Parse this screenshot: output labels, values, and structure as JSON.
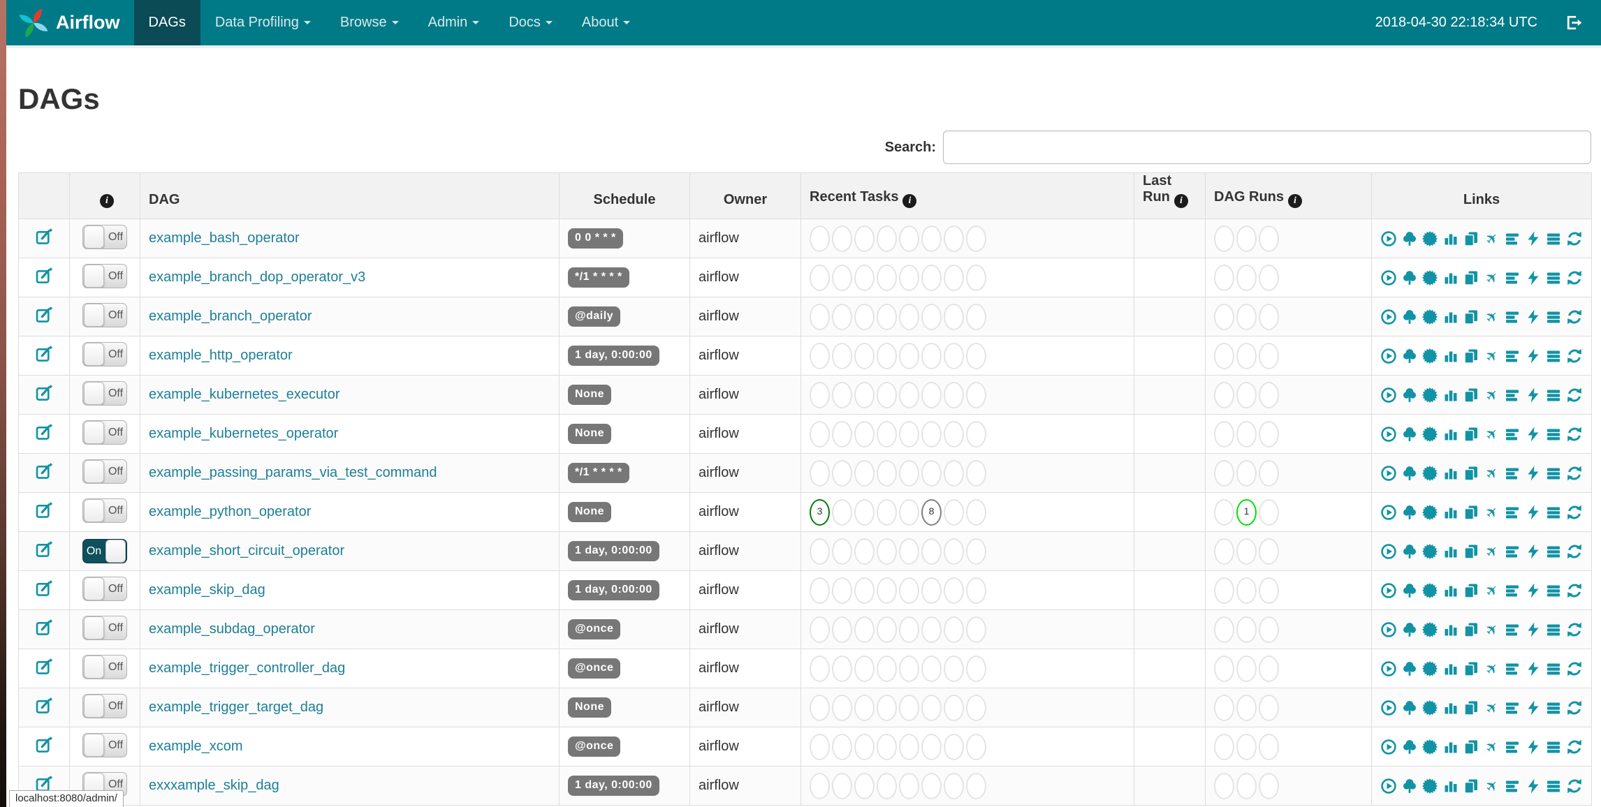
{
  "navbar": {
    "brand": "Airflow",
    "items": [
      {
        "label": "DAGs",
        "slug": "dags",
        "active": true,
        "caret": false
      },
      {
        "label": "Data Profiling",
        "slug": "data-profiling",
        "active": false,
        "caret": true
      },
      {
        "label": "Browse",
        "slug": "browse",
        "active": false,
        "caret": true
      },
      {
        "label": "Admin",
        "slug": "admin",
        "active": false,
        "caret": true
      },
      {
        "label": "Docs",
        "slug": "docs",
        "active": false,
        "caret": true
      },
      {
        "label": "About",
        "slug": "about",
        "active": false,
        "caret": true
      }
    ],
    "clock": "2018-04-30 22:18:34 UTC"
  },
  "page": {
    "title": "DAGs"
  },
  "search": {
    "label": "Search:",
    "value": "",
    "placeholder": ""
  },
  "table": {
    "headers": [
      {
        "label": "",
        "info": false
      },
      {
        "label": "",
        "info": true
      },
      {
        "label": "DAG",
        "info": false
      },
      {
        "label": "Schedule",
        "info": false
      },
      {
        "label": "Owner",
        "info": false
      },
      {
        "label": "Recent Tasks",
        "info": true
      },
      {
        "label": "Last Run",
        "info": true
      },
      {
        "label": "DAG Runs",
        "info": true
      },
      {
        "label": "Links",
        "info": false
      }
    ],
    "recent_tasks_slots": 8,
    "dag_runs_slots": 3,
    "links_icons": [
      "trigger-dag-icon",
      "tree-view-icon",
      "graph-view-icon",
      "task-duration-icon",
      "task-tries-icon",
      "landing-times-icon",
      "gantt-view-icon",
      "code-view-icon",
      "logs-icon",
      "refresh-icon"
    ],
    "rows": [
      {
        "dag_id": "example_bash_operator",
        "toggle": "Off",
        "schedule": "0 0 * * *",
        "owner": "airflow",
        "recent_tasks": [],
        "dag_runs": []
      },
      {
        "dag_id": "example_branch_dop_operator_v3",
        "toggle": "Off",
        "schedule": "*/1 * * * *",
        "owner": "airflow",
        "recent_tasks": [],
        "dag_runs": []
      },
      {
        "dag_id": "example_branch_operator",
        "toggle": "Off",
        "schedule": "@daily",
        "owner": "airflow",
        "recent_tasks": [],
        "dag_runs": []
      },
      {
        "dag_id": "example_http_operator",
        "toggle": "Off",
        "schedule": "1 day, 0:00:00",
        "owner": "airflow",
        "recent_tasks": [],
        "dag_runs": []
      },
      {
        "dag_id": "example_kubernetes_executor",
        "toggle": "Off",
        "schedule": "None",
        "owner": "airflow",
        "recent_tasks": [],
        "dag_runs": []
      },
      {
        "dag_id": "example_kubernetes_operator",
        "toggle": "Off",
        "schedule": "None",
        "owner": "airflow",
        "recent_tasks": [],
        "dag_runs": []
      },
      {
        "dag_id": "example_passing_params_via_test_command",
        "toggle": "Off",
        "schedule": "*/1 * * * *",
        "owner": "airflow",
        "recent_tasks": [],
        "dag_runs": []
      },
      {
        "dag_id": "example_python_operator",
        "toggle": "Off",
        "schedule": "None",
        "owner": "airflow",
        "recent_tasks": [
          {
            "slot": 0,
            "count": "3",
            "state": "success"
          },
          {
            "slot": 5,
            "count": "8",
            "state": "queued"
          }
        ],
        "dag_runs": [
          {
            "slot": 1,
            "count": "1",
            "state": "running"
          }
        ]
      },
      {
        "dag_id": "example_short_circuit_operator",
        "toggle": "On",
        "schedule": "1 day, 0:00:00",
        "owner": "airflow",
        "recent_tasks": [],
        "dag_runs": []
      },
      {
        "dag_id": "example_skip_dag",
        "toggle": "Off",
        "schedule": "1 day, 0:00:00",
        "owner": "airflow",
        "recent_tasks": [],
        "dag_runs": []
      },
      {
        "dag_id": "example_subdag_operator",
        "toggle": "Off",
        "schedule": "@once",
        "owner": "airflow",
        "recent_tasks": [],
        "dag_runs": []
      },
      {
        "dag_id": "example_trigger_controller_dag",
        "toggle": "Off",
        "schedule": "@once",
        "owner": "airflow",
        "recent_tasks": [],
        "dag_runs": []
      },
      {
        "dag_id": "example_trigger_target_dag",
        "toggle": "Off",
        "schedule": "None",
        "owner": "airflow",
        "recent_tasks": [],
        "dag_runs": []
      },
      {
        "dag_id": "example_xcom",
        "toggle": "Off",
        "schedule": "@once",
        "owner": "airflow",
        "recent_tasks": [],
        "dag_runs": []
      },
      {
        "dag_id": "exxxample_skip_dag",
        "toggle": "Off",
        "schedule": "1 day, 0:00:00",
        "owner": "airflow",
        "recent_tasks": [],
        "dag_runs": []
      }
    ]
  },
  "colors": {
    "navbar_bg": "#007A87",
    "navbar_active_bg": "#0b4b55",
    "accent_teal": "#1193a5",
    "link_teal": "#1d7f96",
    "badge_bg": "#777777",
    "circle_border": "#e4e4e4",
    "states": {
      "success": "#067a00",
      "queued": "#808080",
      "running": "#00e000"
    }
  },
  "status_bar": {
    "text": "localhost:8080/admin/"
  }
}
